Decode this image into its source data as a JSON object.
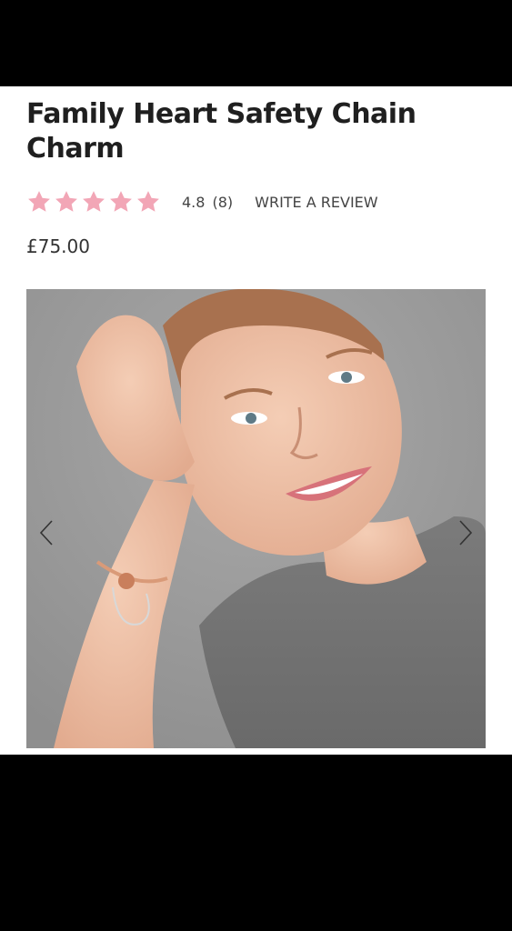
{
  "product": {
    "title_line1": "Family Heart Safety Chain",
    "title_line2": "Charm",
    "rating_value": "4.8",
    "review_count": "(8)",
    "star_count": 5,
    "write_review_label": "WRITE A REVIEW",
    "price": "£75.00"
  },
  "colors": {
    "star": "#f2a6b6",
    "text": "#1f1f1f",
    "background": "#ffffff"
  },
  "icons": {
    "star": "star-icon",
    "prev": "chevron-left-icon",
    "next": "chevron-right-icon"
  }
}
